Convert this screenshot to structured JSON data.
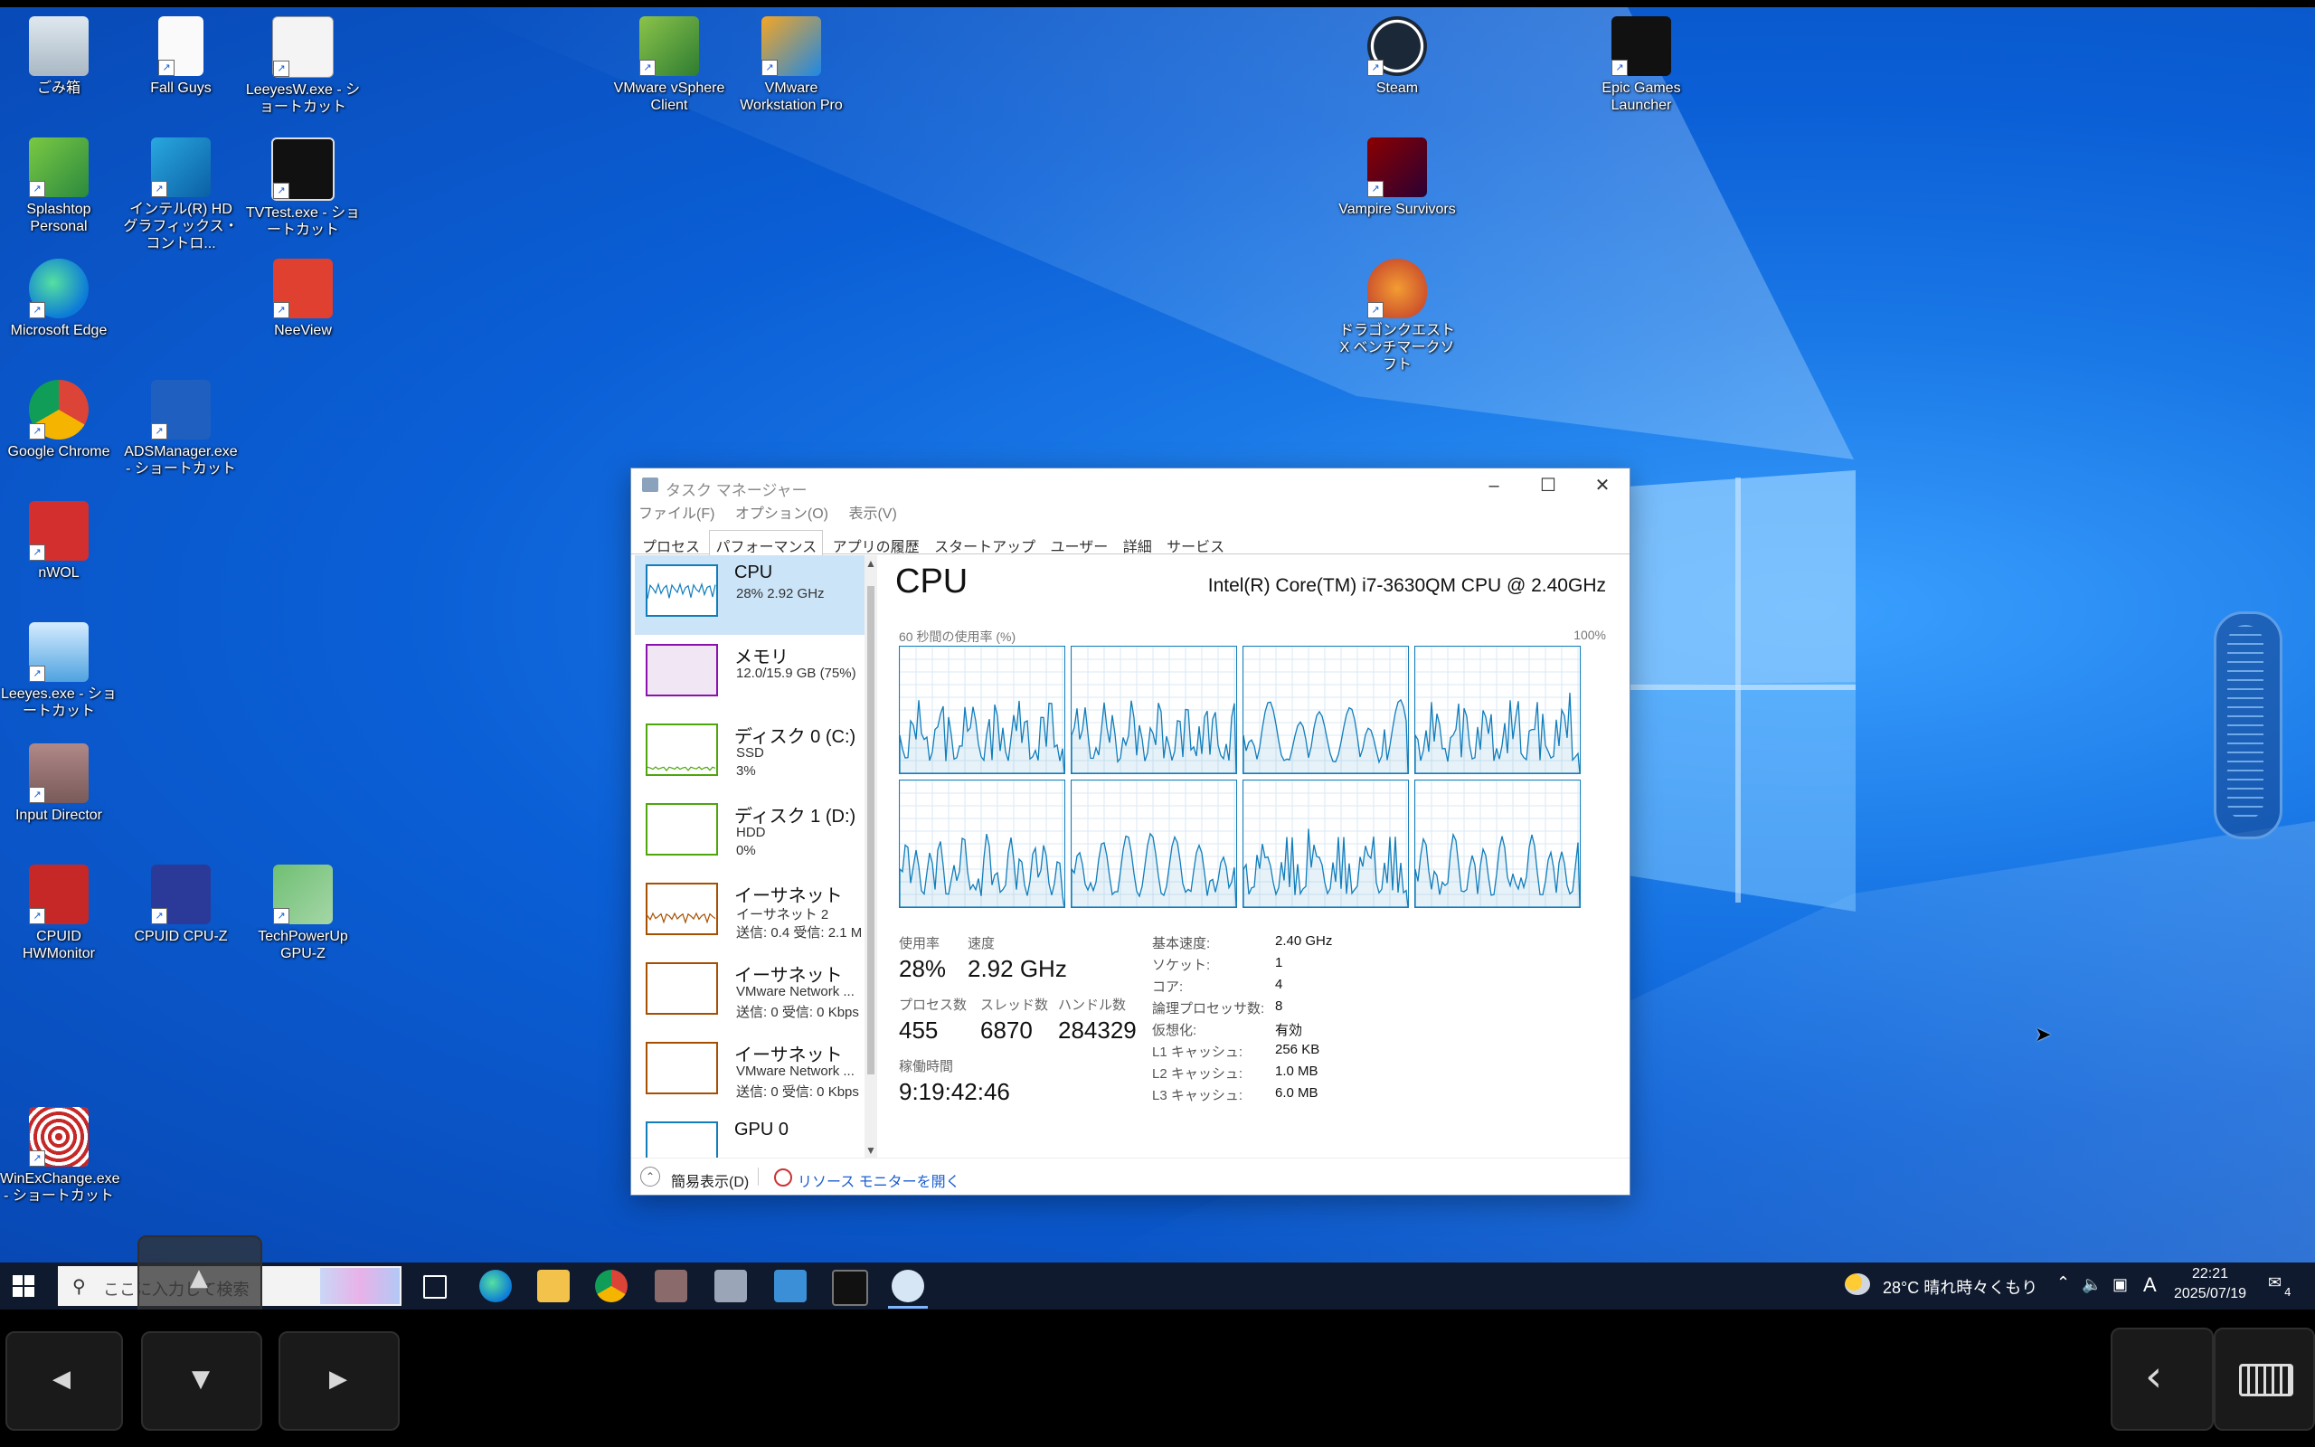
{
  "desktop": {
    "icons": [
      {
        "label": "ごみ箱",
        "icon": "recycle-bin-icon"
      },
      {
        "label": "Fall Guys",
        "icon": "blank-file-icon"
      },
      {
        "label": "LeeyesW.exe - ショートカット",
        "icon": "leeyes-icon"
      },
      {
        "label": "VMware vSphere Client",
        "icon": "vsphere-icon"
      },
      {
        "label": "VMware Workstation Pro",
        "icon": "vmware-workstation-icon"
      },
      {
        "label": "Steam",
        "icon": "steam-icon"
      },
      {
        "label": "Epic Games Launcher",
        "icon": "epic-games-icon"
      },
      {
        "label": "Splashtop Personal",
        "icon": "splashtop-icon"
      },
      {
        "label": "インテル(R) HD グラフィックス・コントロ...",
        "icon": "intel-graphics-icon"
      },
      {
        "label": "TVTest.exe - ショートカット",
        "icon": "tvtest-icon"
      },
      {
        "label": "Vampire Survivors",
        "icon": "vampire-survivors-icon"
      },
      {
        "label": "Microsoft Edge",
        "icon": "edge-icon"
      },
      {
        "label": "NeeView",
        "icon": "neeview-icon"
      },
      {
        "label": "ドラゴンクエストX ベンチマークソフト",
        "icon": "dragon-quest-icon"
      },
      {
        "label": "Google Chrome",
        "icon": "chrome-icon"
      },
      {
        "label": "ADSManager.exe - ショートカット",
        "icon": "db-icon"
      },
      {
        "label": "nWOL",
        "icon": "power-icon"
      },
      {
        "label": "Leeyes.exe - ショートカット",
        "icon": "leeyes-sprout-icon"
      },
      {
        "label": "Input Director",
        "icon": "input-director-icon"
      },
      {
        "label": "CPUID HWMonitor",
        "icon": "hwmonitor-icon"
      },
      {
        "label": "CPUID CPU-Z",
        "icon": "cpuz-icon"
      },
      {
        "label": "TechPowerUp GPU-Z",
        "icon": "gpuz-icon"
      },
      {
        "label": "WinExChange.exe - ショートカット",
        "icon": "winexchange-icon"
      }
    ]
  },
  "taskmgr": {
    "title": "タスク マネージャー",
    "menu": [
      "ファイル(F)",
      "オプション(O)",
      "表示(V)"
    ],
    "tabs": [
      "プロセス",
      "パフォーマンス",
      "アプリの履歴",
      "スタートアップ",
      "ユーザー",
      "詳細",
      "サービス"
    ],
    "active_tab": "パフォーマンス",
    "sidebar": [
      {
        "name": "CPU",
        "l2": "28%  2.92 GHz",
        "l3": "",
        "color": "#117dbb"
      },
      {
        "name": "メモリ",
        "l2": "12.0/15.9 GB (75%)",
        "l3": "",
        "color": "#8b12ae"
      },
      {
        "name": "ディスク 0 (C:)",
        "l2": "SSD",
        "l3": "3%",
        "color": "#4da60c"
      },
      {
        "name": "ディスク 1 (D:)",
        "l2": "HDD",
        "l3": "0%",
        "color": "#4da60c"
      },
      {
        "name": "イーサネット",
        "l2": "イーサネット 2",
        "l3": "送信: 0.4 受信: 2.1 M",
        "color": "#a74f01"
      },
      {
        "name": "イーサネット",
        "l2": "VMware Network ...",
        "l3": "送信: 0 受信: 0 Kbps",
        "color": "#a74f01"
      },
      {
        "name": "イーサネット",
        "l2": "VMware Network ...",
        "l3": "送信: 0 受信: 0 Kbps",
        "color": "#a74f01"
      },
      {
        "name": "GPU 0",
        "l2": "",
        "l3": "",
        "color": "#117dbb"
      }
    ],
    "main": {
      "title": "CPU",
      "model": "Intel(R) Core(TM) i7-3630QM CPU @ 2.40GHz",
      "graph_left_label": "60 秒間の使用率 (%)",
      "graph_right_label": "100%",
      "usage_label": "使用率",
      "usage": "28%",
      "speed_label": "速度",
      "speed": "2.92 GHz",
      "processes_label": "プロセス数",
      "processes": "455",
      "threads_label": "スレッド数",
      "threads": "6870",
      "handles_label": "ハンドル数",
      "handles": "284329",
      "uptime_label": "稼働時間",
      "uptime": "9:19:42:46",
      "specs": [
        {
          "k": "基本速度:",
          "v": "2.40 GHz"
        },
        {
          "k": "ソケット:",
          "v": "1"
        },
        {
          "k": "コア:",
          "v": "4"
        },
        {
          "k": "論理プロセッサ数:",
          "v": "8"
        },
        {
          "k": "仮想化:",
          "v": "有効"
        },
        {
          "k": "L1 キャッシュ:",
          "v": "256 KB"
        },
        {
          "k": "L2 キャッシュ:",
          "v": "1.0 MB"
        },
        {
          "k": "L3 キャッシュ:",
          "v": "6.0 MB"
        }
      ]
    },
    "footer": {
      "fewer": "簡易表示(D)",
      "resmon": "リソース モニターを開く"
    }
  },
  "taskbar": {
    "search_placeholder": "ここに入力して検索",
    "weather": "28°C  晴れ時々くもり",
    "ime": "A",
    "time": "22:21",
    "date": "2025/07/19",
    "notification_count": "4"
  },
  "colors": {
    "accent": "#117dbb",
    "taskbar": "#0f1a2e"
  }
}
